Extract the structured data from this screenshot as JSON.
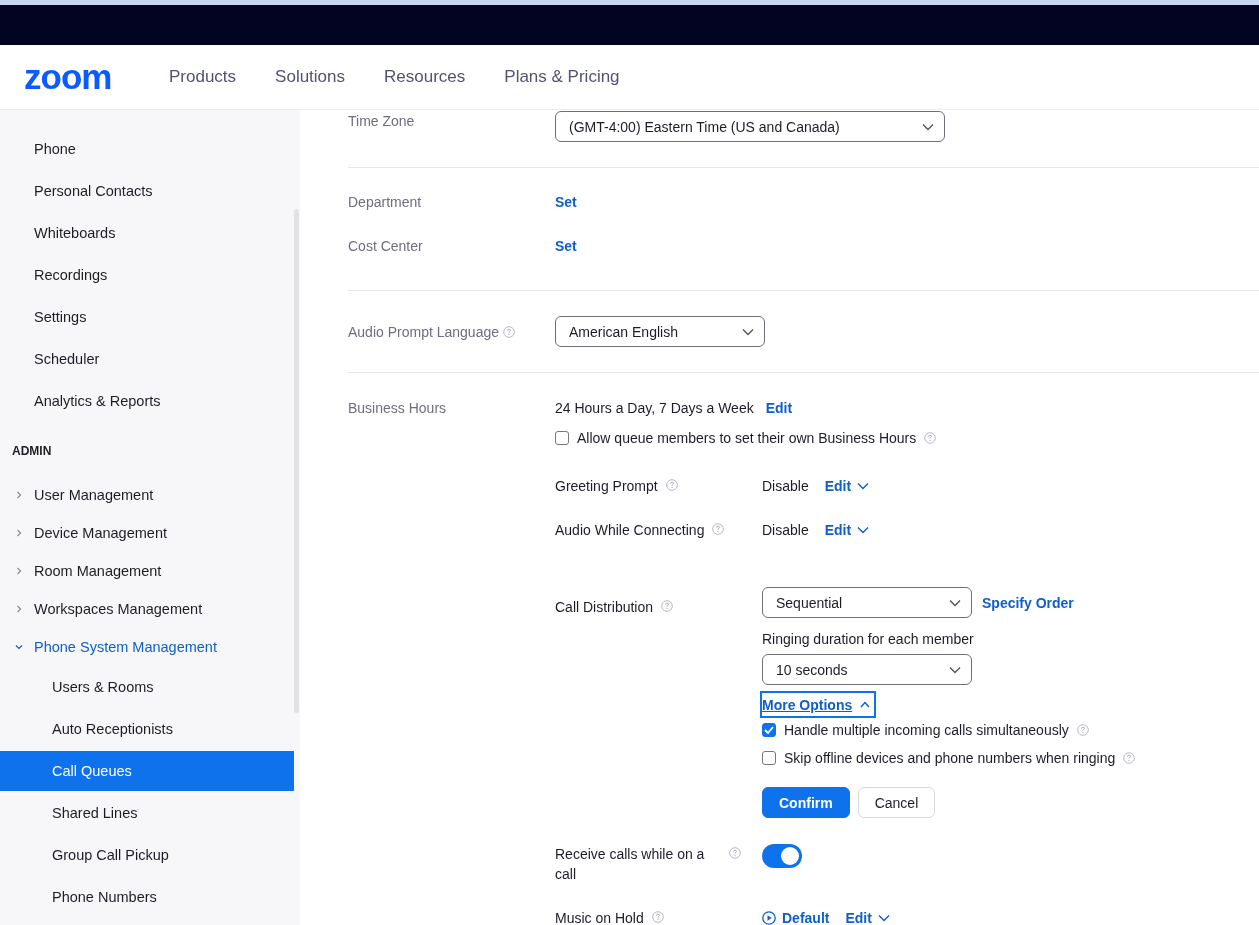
{
  "header": {
    "logo": "zoom",
    "nav": [
      "Products",
      "Solutions",
      "Resources",
      "Plans & Pricing"
    ]
  },
  "sidebar": {
    "items": [
      {
        "label": "Phone",
        "selected": false
      },
      {
        "label": "Personal Contacts",
        "selected": false
      },
      {
        "label": "Whiteboards",
        "selected": false
      },
      {
        "label": "Recordings",
        "selected": false
      },
      {
        "label": "Settings",
        "selected": false
      },
      {
        "label": "Scheduler",
        "selected": false
      },
      {
        "label": "Analytics & Reports",
        "selected": false
      }
    ],
    "section": "ADMIN",
    "admin_items": [
      {
        "label": "User Management",
        "expanded": false
      },
      {
        "label": "Device Management",
        "expanded": false
      },
      {
        "label": "Room Management",
        "expanded": false
      },
      {
        "label": "Workspaces Management",
        "expanded": false
      },
      {
        "label": "Phone System Management",
        "expanded": true,
        "children": [
          {
            "label": "Users & Rooms",
            "selected": false
          },
          {
            "label": "Auto Receptionists",
            "selected": false
          },
          {
            "label": "Call Queues",
            "selected": true
          },
          {
            "label": "Shared Lines",
            "selected": false
          },
          {
            "label": "Group Call Pickup",
            "selected": false
          },
          {
            "label": "Phone Numbers",
            "selected": false
          }
        ]
      }
    ]
  },
  "sections": [
    {
      "rows": [
        {
          "label": "Time Zone",
          "kind": "select",
          "value": "(GMT-4:00) Eastern Time (US and Canada)",
          "help": false
        }
      ]
    },
    {
      "rows": [
        {
          "label": "Department",
          "kind": "link",
          "value": "Set",
          "help": false
        },
        {
          "label": "Cost Center",
          "kind": "link",
          "value": "Set",
          "help": false
        }
      ]
    },
    {
      "rows": [
        {
          "label": "Audio Prompt Language",
          "kind": "select",
          "value": "American English",
          "help": true
        }
      ]
    }
  ],
  "business_hours": {
    "label": "Business Hours",
    "value": "24 Hours a Day, 7 Days a Week",
    "link": "Edit",
    "checkbox": {
      "label": "Allow queue members to set their own Business Hours",
      "checked": false,
      "help": true
    },
    "settings": [
      {
        "label": "Greeting Prompt",
        "kind": "edit",
        "value": "Disable",
        "link": "Edit",
        "help": true
      },
      {
        "label": "Audio While Connecting",
        "kind": "edit",
        "value": "Disable",
        "link": "Edit",
        "help": true
      },
      {
        "label": "Call Distribution",
        "kind": "distribution",
        "help": true,
        "select": "Sequential",
        "link": "Specify Order",
        "sublabel": "Ringing duration for each member",
        "duration": "10 seconds",
        "more": "More Options",
        "expanded": true,
        "options": [
          {
            "label": "Handle multiple incoming calls simultaneously",
            "checked": true,
            "help": true
          },
          {
            "label": "Skip offline devices and phone numbers when ringing",
            "checked": false,
            "help": true
          }
        ],
        "buttons": [
          "Confirm",
          "Cancel"
        ]
      },
      {
        "label": "Receive calls while on a call",
        "kind": "toggle",
        "on": true,
        "help": true
      },
      {
        "label": "Music on Hold",
        "kind": "music",
        "value": "Default",
        "link": "Edit",
        "help": true
      }
    ]
  }
}
